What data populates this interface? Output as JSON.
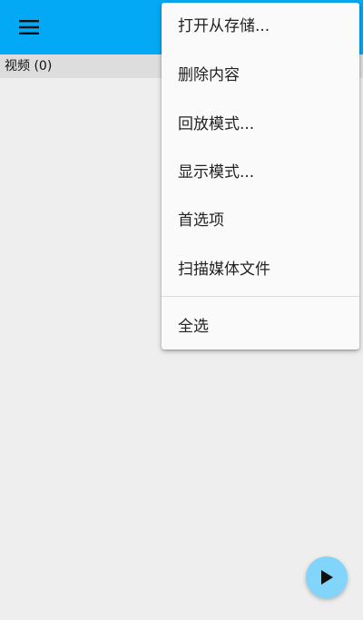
{
  "header": {
    "menu_icon": "hamburger-menu-icon",
    "color": "#03a9f4"
  },
  "subheader": {
    "label": "视频 (0)"
  },
  "overflow_menu": {
    "items": [
      {
        "label": "打开从存储..."
      },
      {
        "label": "删除内容"
      },
      {
        "label": "回放模式..."
      },
      {
        "label": "显示模式..."
      },
      {
        "label": "首选项"
      },
      {
        "label": "扫描媒体文件"
      },
      {
        "label": "全选"
      }
    ]
  },
  "fab": {
    "icon": "play-icon",
    "color": "#81d4fa"
  }
}
